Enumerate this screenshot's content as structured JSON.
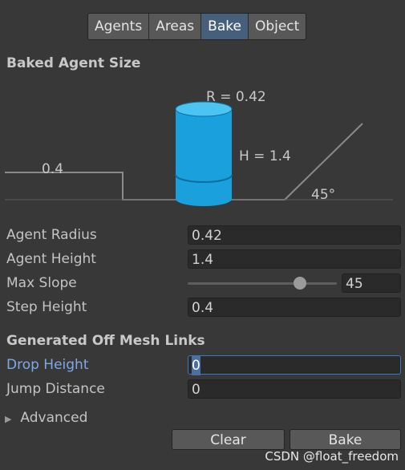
{
  "tabs": [
    {
      "label": "Agents",
      "active": false
    },
    {
      "label": "Areas",
      "active": false
    },
    {
      "label": "Bake",
      "active": true
    },
    {
      "label": "Object",
      "active": false
    }
  ],
  "baked_agent_size": {
    "title": "Baked Agent Size",
    "radius_label": "R = 0.42",
    "height_label": "H = 1.4",
    "step_label": "0.4",
    "slope_label": "45°",
    "cylinder_color": "#1aa0dc"
  },
  "fields": {
    "agent_radius": {
      "label": "Agent Radius",
      "value": "0.42"
    },
    "agent_height": {
      "label": "Agent Height",
      "value": "1.4"
    },
    "max_slope": {
      "label": "Max Slope",
      "value": "45",
      "slider_fraction": 0.75
    },
    "step_height": {
      "label": "Step Height",
      "value": "0.4"
    }
  },
  "off_mesh_links": {
    "title": "Generated Off Mesh Links",
    "drop_height": {
      "label": "Drop Height",
      "value": "0"
    },
    "jump_distance": {
      "label": "Jump Distance",
      "value": "0"
    }
  },
  "advanced": {
    "label": "Advanced"
  },
  "buttons": {
    "clear": "Clear",
    "bake": "Bake"
  },
  "watermark": "CSDN @float_freedom"
}
